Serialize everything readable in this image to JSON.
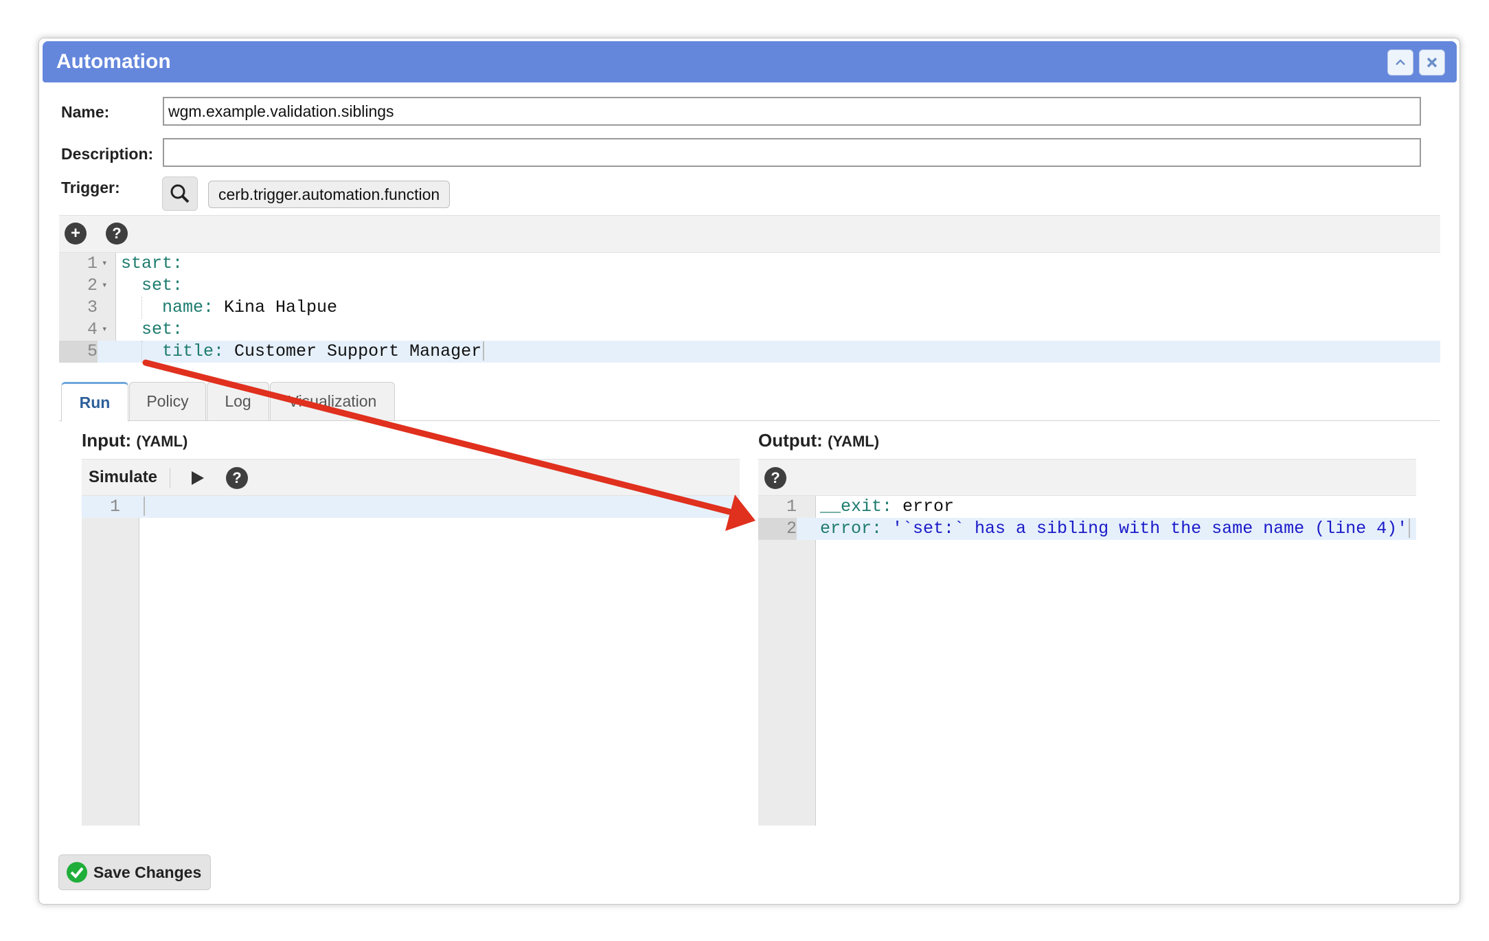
{
  "dialog": {
    "title": "Automation"
  },
  "form": {
    "name_label": "Name:",
    "name_value": "wgm.example.validation.siblings",
    "description_label": "Description:",
    "description_value": "",
    "trigger_label": "Trigger:",
    "trigger_value": "cerb.trigger.automation.function"
  },
  "script_editor": {
    "lines": [
      {
        "num": "1",
        "parts": [
          {
            "t": "start:",
            "c": "k"
          }
        ]
      },
      {
        "num": "2",
        "parts": [
          {
            "t": "  set:",
            "c": "k"
          }
        ]
      },
      {
        "num": "3",
        "parts": [
          {
            "t": "    name:",
            "c": "k"
          },
          {
            "t": " Kina Halpue",
            "c": "v"
          }
        ]
      },
      {
        "num": "4",
        "parts": [
          {
            "t": "  set:",
            "c": "k"
          }
        ]
      },
      {
        "num": "5",
        "parts": [
          {
            "t": "    title:",
            "c": "k"
          },
          {
            "t": " Customer Support Manager",
            "c": "v"
          }
        ]
      }
    ]
  },
  "tabs": [
    "Run",
    "Policy",
    "Log",
    "Visualization"
  ],
  "input_pane": {
    "title": "Input:",
    "subtitle": "(YAML)",
    "simulate_label": "Simulate",
    "line_number": "1"
  },
  "output_pane": {
    "title": "Output:",
    "subtitle": "(YAML)",
    "lines": [
      {
        "num": "1",
        "parts": [
          {
            "t": "__exit:",
            "c": "k"
          },
          {
            "t": " error",
            "c": "v"
          }
        ]
      },
      {
        "num": "2",
        "parts": [
          {
            "t": "error:",
            "c": "k"
          },
          {
            "t": " '`set:` has a sibling with the same name (line 4)'",
            "c": "s"
          }
        ]
      }
    ]
  },
  "footer": {
    "save_label": "Save Changes"
  },
  "colors": {
    "titlebar": "#6487dc",
    "annotation_arrow": "#e0301e",
    "save_check": "#1fae3a"
  }
}
